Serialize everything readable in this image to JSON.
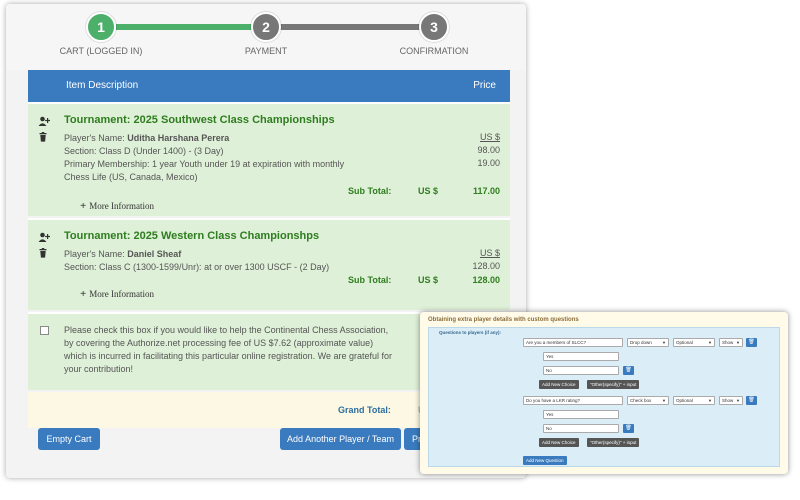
{
  "stepper": {
    "steps": [
      {
        "number": "1",
        "label": "CART (LOGGED IN)",
        "state": "complete",
        "color": "#4caf6a"
      },
      {
        "number": "2",
        "label": "PAYMENT",
        "state": "pending",
        "color": "#777777"
      },
      {
        "number": "3",
        "label": "CONFIRMATION",
        "state": "pending",
        "color": "#777777"
      }
    ]
  },
  "table": {
    "col_description": "Item Description",
    "col_price": "Price"
  },
  "items": [
    {
      "title": "Tournament: 2025 Southwest Class Championships",
      "player_label": "Player's Name: ",
      "player_name": "Uditha Harshana Perera",
      "currency_top": "US $",
      "section": "Section: Class D (Under 1400) - (3 Day)",
      "section_amount": "98.00",
      "membership": "Primary Membership: 1 year Youth under 19 at expiration with monthly Chess Life (US, Canada, Mexico)",
      "membership_amount": "19.00",
      "subtotal_label": "Sub Total:",
      "subtotal_currency": "US $",
      "subtotal": "117.00",
      "more_info": "More Information"
    },
    {
      "title": "Tournament: 2025 Western Class Championshps",
      "player_label": "Player's Name: ",
      "player_name": "Daniel Sheaf",
      "currency_top": "US $",
      "section": "Section: Class C (1300-1599/Unr): at or over 1300 USCF - (2 Day)",
      "section_amount": "128.00",
      "subtotal_label": "Sub Total:",
      "subtotal_currency": "US $",
      "subtotal": "128.00",
      "more_info": "More Information"
    }
  ],
  "contribution": {
    "text": "Please check this box if you would like to help the Continental Chess Association, by covering the Authorize.net processing fee of US $7.62 (approximate value) which is incurred in facilitating this particular online registration. We are grateful for your contribution!",
    "checked": false
  },
  "grand_total": {
    "label": "Grand Total:",
    "currency_partial": "U"
  },
  "buttons": {
    "empty_cart": "Empty Cart",
    "add_player": "Add Another Player / Team",
    "proceed_partial": "Pr"
  },
  "questions_panel": {
    "title": "Obtaining extra player details with custom questions",
    "heading": "Questions to players (if any):",
    "questions": [
      {
        "question": "Are you a members of SLCC?",
        "type": "Drop down",
        "required": "Optional",
        "visibility": "Show",
        "choices": [
          "Yes",
          "No"
        ]
      },
      {
        "question": "Do you have a LKR rating?",
        "type": "Check box",
        "required": "Optional",
        "visibility": "Show",
        "choices": [
          "Yes",
          "No"
        ]
      }
    ],
    "add_choice": "Add New Choice",
    "other_input": "\"Other(specify)\" + input",
    "add_question": "Add New Question"
  },
  "icons": {
    "add_user": "user-plus-icon",
    "delete": "trash-icon",
    "more": "plus-icon",
    "dropdown": "caret-down-icon"
  },
  "colors": {
    "primary": "#3a7bbf",
    "success_text": "#2e7d1f",
    "item_bg": "#dff0d8",
    "grand_bg": "#fcf8e3",
    "panel_bg": "#dbedf7"
  }
}
